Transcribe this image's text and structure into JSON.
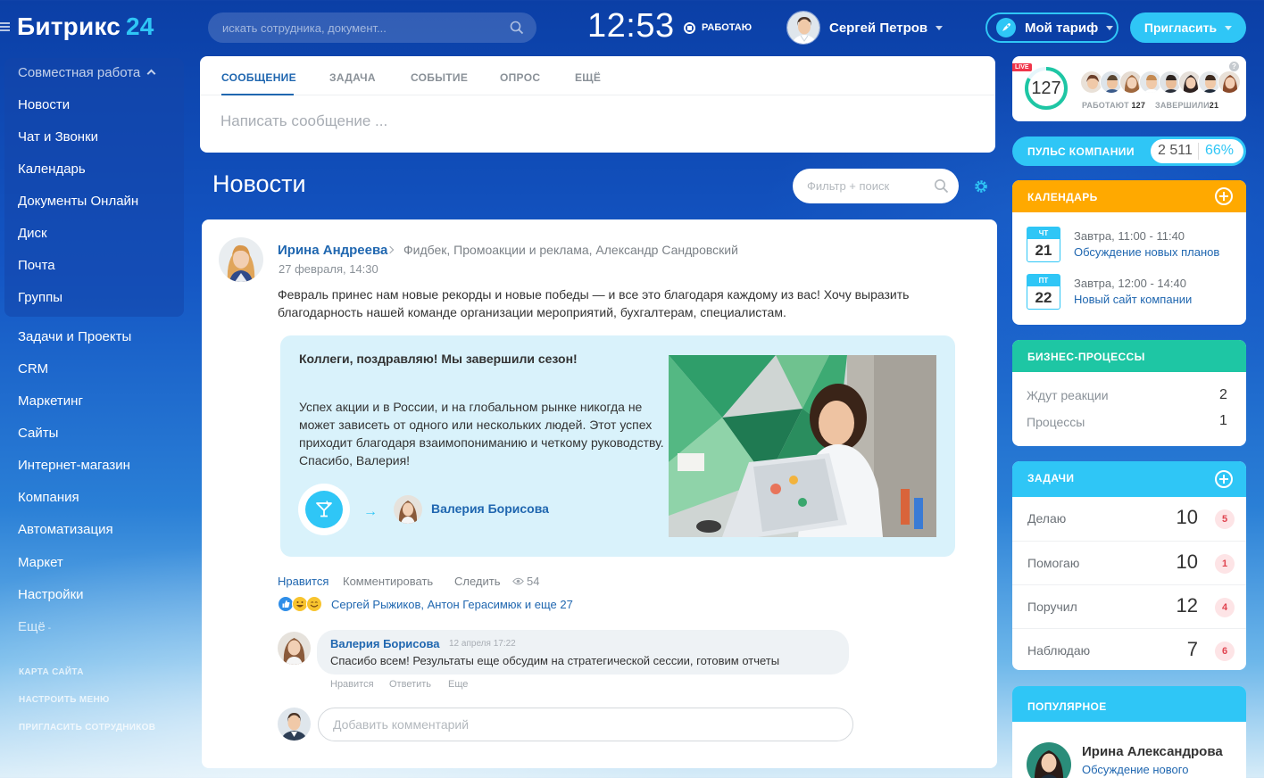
{
  "header": {
    "logo_text": "Битрикс",
    "logo_num": "24",
    "search_placeholder": "искать сотрудника, документ...",
    "clock": "12:53",
    "work_status": "РАБОТАЮ",
    "user_name": "Сергей Петров",
    "tariff_label": "Мой тариф",
    "invite_label": "Пригласить"
  },
  "sidebar": {
    "group_title": "Совместная работа",
    "group_items": [
      "Новости",
      "Чат и Звонки",
      "Календарь",
      "Документы Онлайн",
      "Диск",
      "Почта",
      "Группы"
    ],
    "items": [
      "Задачи и Проекты",
      "CRM",
      "Маркетинг",
      "Сайты",
      "Интернет-магазин",
      "Компания",
      "Автоматизация",
      "Маркет",
      "Настройки"
    ],
    "more_label": "Ещё",
    "small_links": [
      "КАРТА САЙТА",
      "НАСТРОИТЬ МЕНЮ",
      "ПРИГЛАСИТЬ СОТРУДНИКОВ"
    ]
  },
  "composer": {
    "tabs": [
      "СООБЩЕНИЕ",
      "ЗАДАЧА",
      "СОБЫТИЕ",
      "ОПРОС",
      "ЕЩЁ"
    ],
    "active_tab": "СООБЩЕНИЕ",
    "placeholder": "Написать сообщение ..."
  },
  "feed": {
    "title": "Новости",
    "filter_placeholder": "Фильтр + поиск"
  },
  "post": {
    "author": "Ирина Андреева",
    "destinations": "Фидбек, Промоакции и реклама, Александр Сандровский",
    "date": "27 февраля, 14:30",
    "text": "Февраль принес нам новые рекорды и новые победы — и все это благодаря каждому из вас! Хочу выразить благодарность нашей команде организации мероприятий, бухгалтерам, специалистам.",
    "gratitude": {
      "title": "Коллеги, поздравляю! Мы завершили сезон!",
      "body": "Успех акции и в России, и на глобальном рынке никогда не может зависеть от одного или нескольких людей. Этот успех приходит благодаря взаимопониманию и четкому руководству. Спасибо, Валерия!",
      "recipient": "Валерия Борисова"
    },
    "actions": {
      "like": "Нравится",
      "comment": "Комментировать",
      "follow": "Следить",
      "views": "54"
    },
    "reacted_users": "Сергей Рыжиков, Антон Герасимюк и еще 27",
    "comment": {
      "author": "Валерия Борисова",
      "date": "12 апреля 17:22",
      "text": "Спасибо всем! Результаты еще обсудим на стратегической сессии, готовим отчеты",
      "actions": [
        "Нравится",
        "Ответить",
        "Еще"
      ]
    },
    "comment_placeholder": "Добавить комментарий"
  },
  "right": {
    "stats": {
      "live": "LIVE",
      "counter": "127",
      "working_label": "РАБОТАЮТ",
      "working_value": "127",
      "finished_label": "ЗАВЕРШИЛИ",
      "finished_value": "21"
    },
    "pulse": {
      "label": "ПУЛЬС КОМПАНИИ",
      "value": "2 511",
      "percent": "66%"
    },
    "calendar": {
      "title": "КАЛЕНДАРЬ",
      "events": [
        {
          "dow": "ЧТ",
          "day": "21",
          "time": "Завтра, 11:00 - 11:40",
          "title": "Обсуждение новых планов"
        },
        {
          "dow": "ПТ",
          "day": "22",
          "time": "Завтра, 12:00 - 14:40",
          "title": "Новый сайт компании"
        }
      ]
    },
    "bp": {
      "title": "БИЗНЕС-ПРОЦЕССЫ",
      "rows": [
        {
          "label": "Ждут реакции",
          "value": "2"
        },
        {
          "label": "Процессы",
          "value": "1"
        }
      ]
    },
    "tasks": {
      "title": "ЗАДАЧИ",
      "rows": [
        {
          "label": "Делаю",
          "value": "10",
          "badge": "5"
        },
        {
          "label": "Помогаю",
          "value": "10",
          "badge": "1"
        },
        {
          "label": "Поручил",
          "value": "12",
          "badge": "4"
        },
        {
          "label": "Наблюдаю",
          "value": "7",
          "badge": "6"
        }
      ]
    },
    "popular": {
      "title": "ПОПУЛЯРНОЕ",
      "name": "Ирина Александрова",
      "subtitle": "Обсуждение нового"
    }
  },
  "colors": {
    "accent": "#2fc6f6",
    "link": "#2067b0",
    "calendar_header": "#ffa900",
    "bp_header": "#1ec6a4",
    "tasks_header": "#2fc6f6"
  }
}
